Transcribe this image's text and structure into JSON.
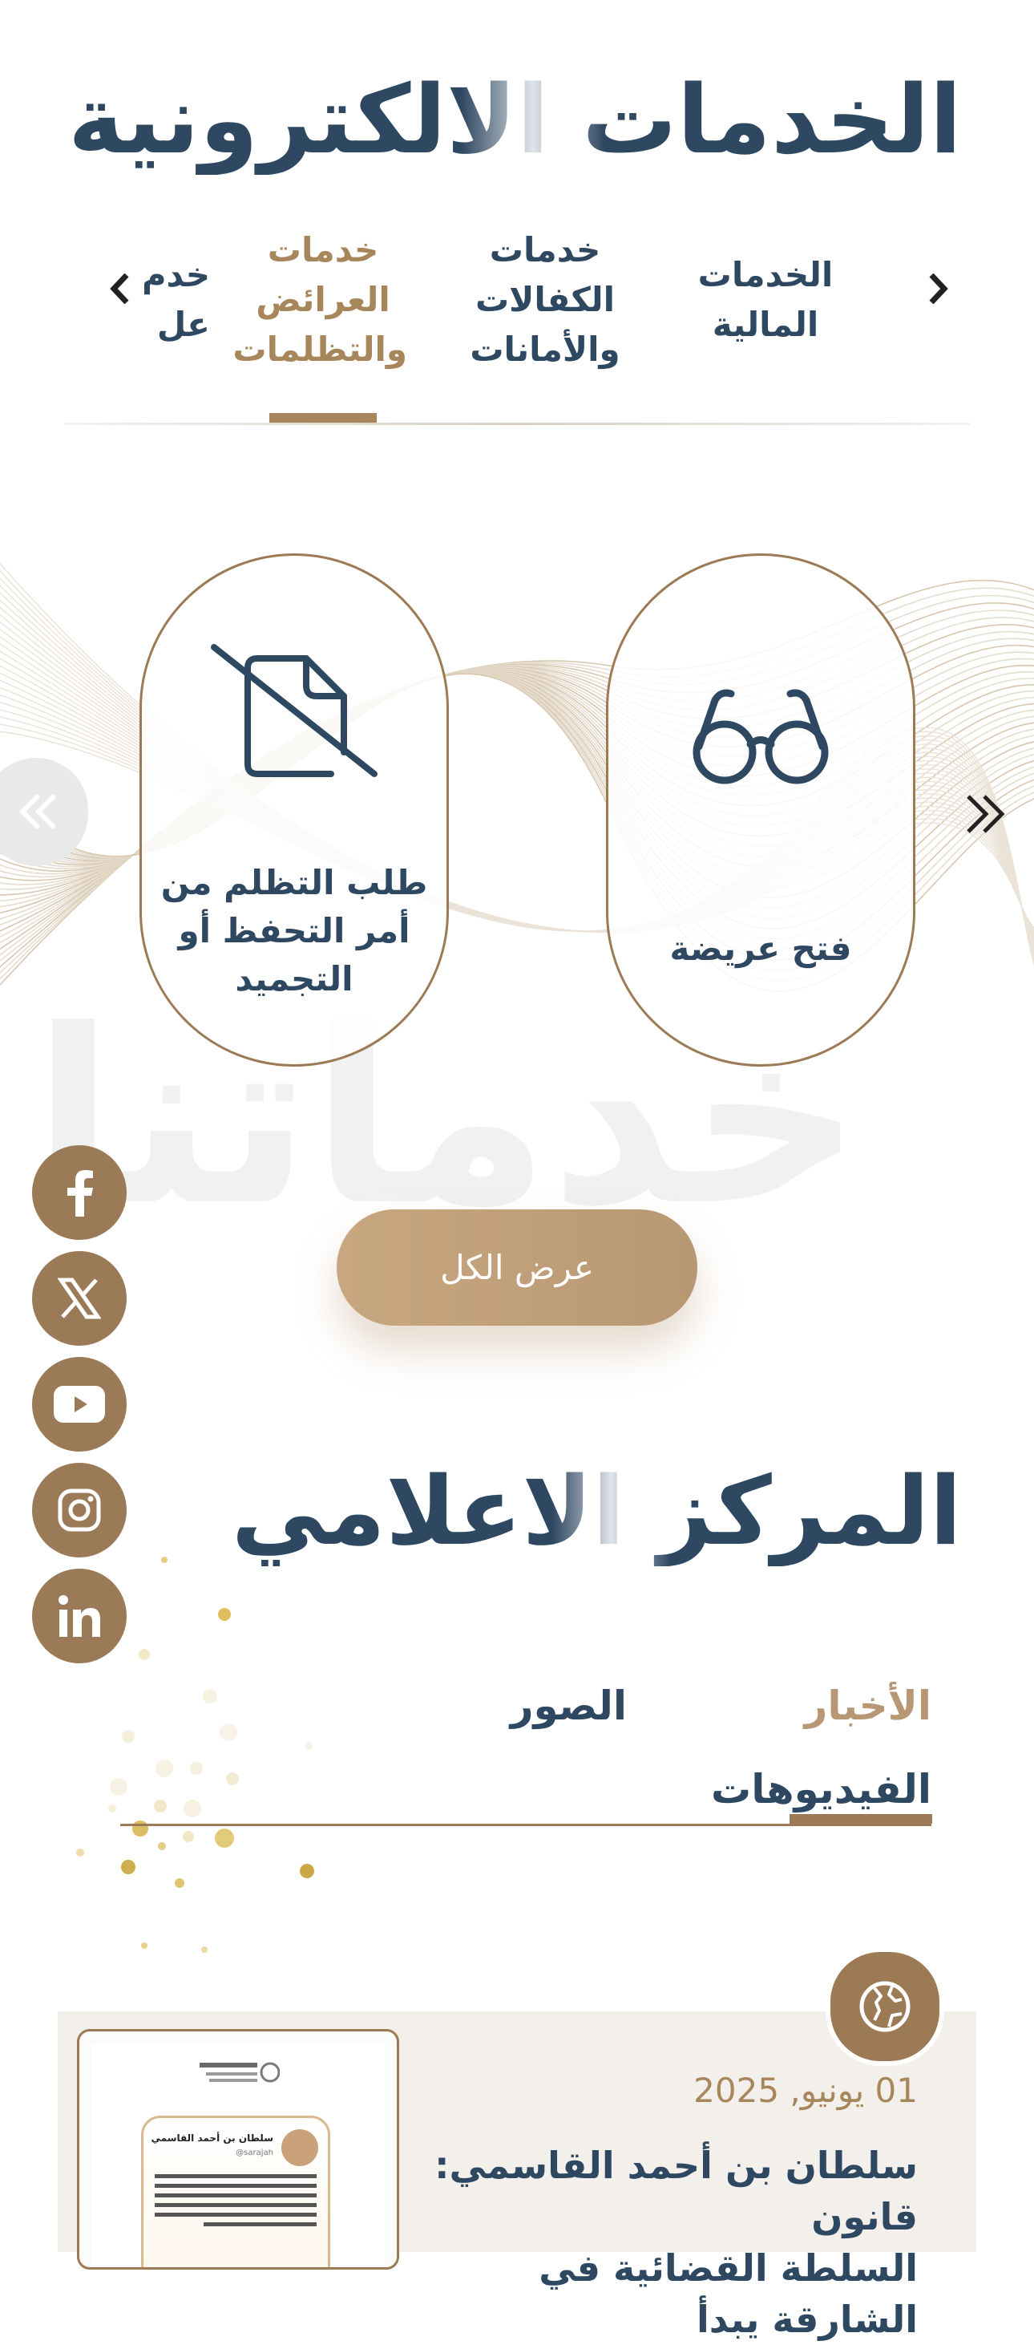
{
  "services": {
    "title": "الخدمات الالكترونية",
    "tabs": [
      {
        "line1": "الخدمات",
        "line2": "المالية",
        "line3": ""
      },
      {
        "line1": "خدمات",
        "line2": "الكفالات",
        "line3": "والأمانات"
      },
      {
        "line1": "خدمات",
        "line2": "العرائض",
        "line3": "والتظلمات"
      },
      {
        "line1": "خدم",
        "line2": "عل",
        "line3": ""
      }
    ],
    "active_tab_index": 2,
    "cards": [
      {
        "icon": "glasses-icon",
        "label1": "فتح عريضة",
        "label2": "",
        "label3": ""
      },
      {
        "icon": "file-off-icon",
        "label1": "طلب التظلم من",
        "label2": "أمر التحفظ أو",
        "label3": "التجميد"
      }
    ],
    "watermark": "خدماتنا",
    "view_all": "عرض الكل"
  },
  "social": [
    "facebook-icon",
    "x-icon",
    "youtube-icon",
    "instagram-icon",
    "linkedin-icon"
  ],
  "media": {
    "title": "المركز الاعلامي",
    "tabs": {
      "news": "الأخبار",
      "photos": "الصور",
      "videos": "الفيديوهات"
    },
    "active_tab": "news"
  },
  "news_item": {
    "date": "01 يونيو, 2025",
    "title_line1": "سلطان بن أحمد القاسمي: قانون",
    "title_line2": "السلطة القضائية في الشارقة يبدأ",
    "thumb_account": "سلطان بن أحمد القاسمي",
    "thumb_handle": "@sarajah"
  },
  "colors": {
    "navy": "#2f4861",
    "gold": "#a8865c",
    "gold_dark": "#9c7a55"
  }
}
